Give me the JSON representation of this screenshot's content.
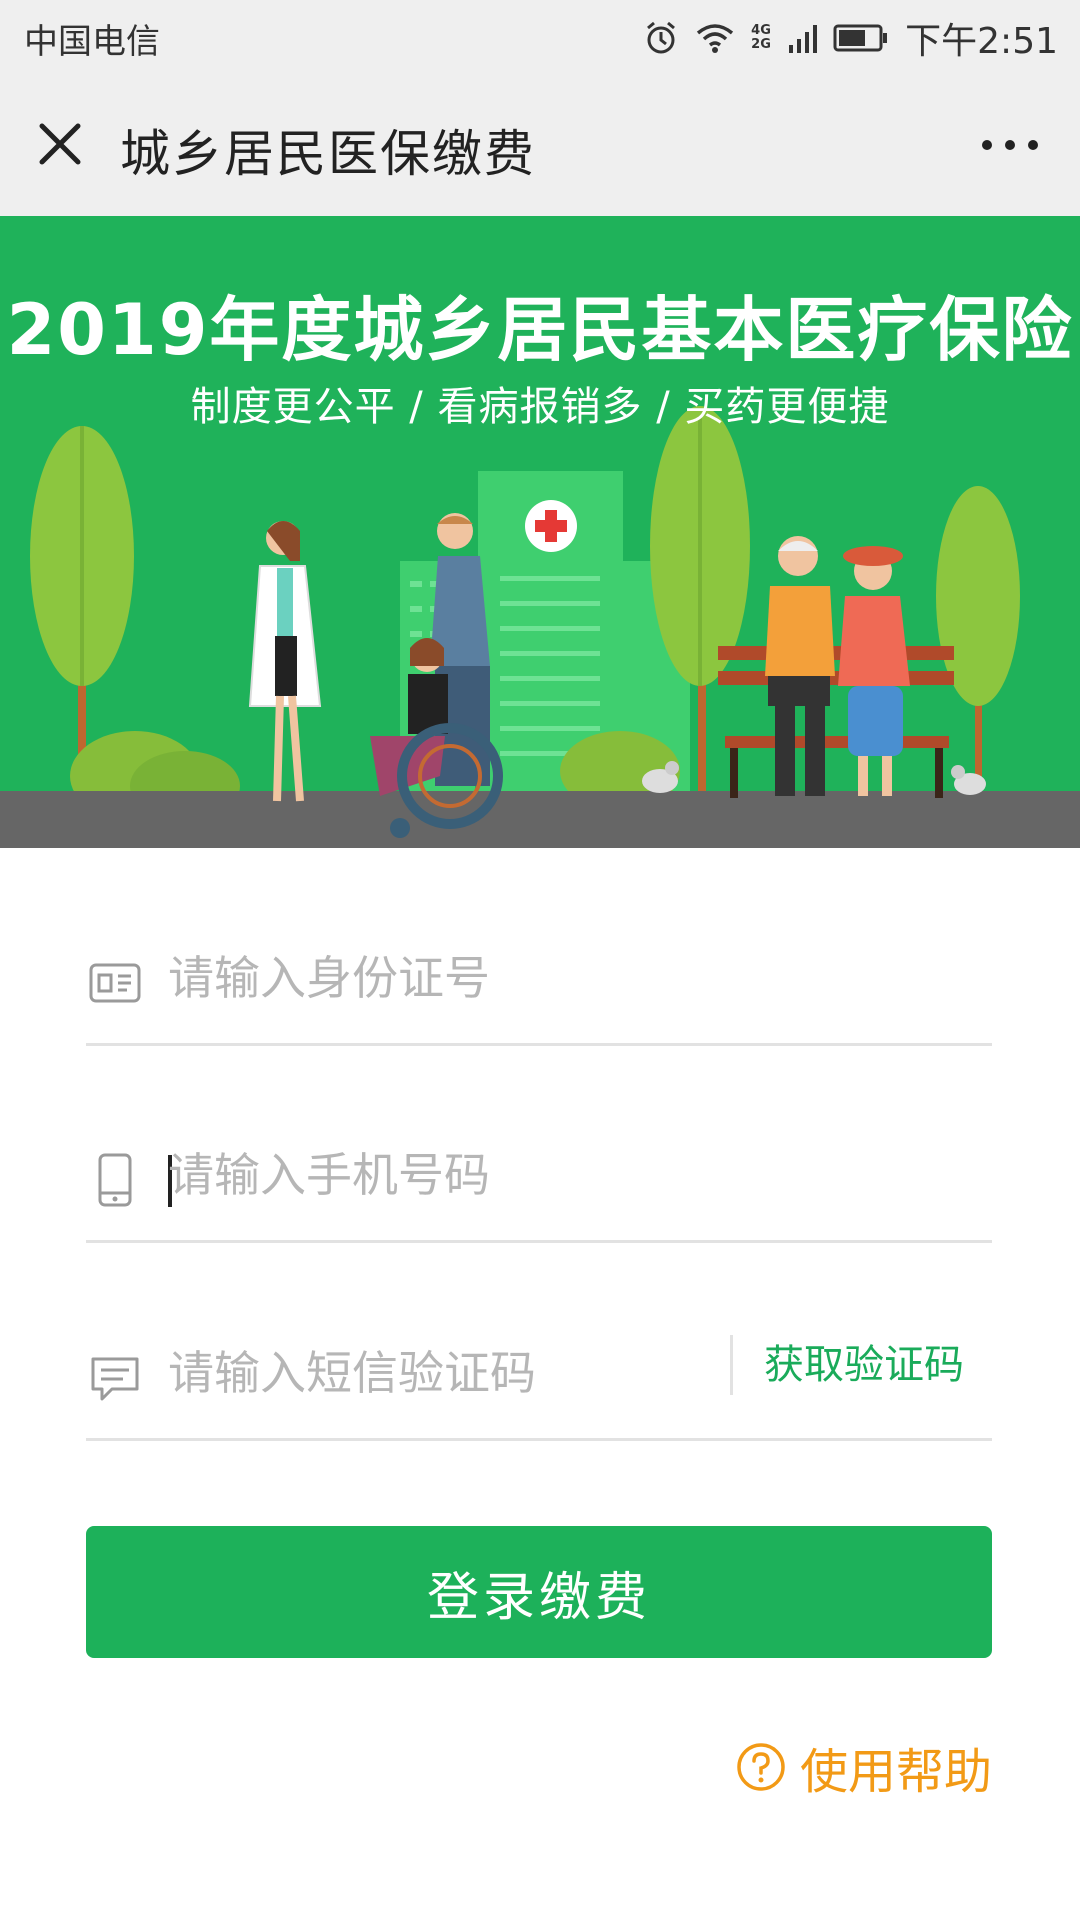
{
  "status_bar": {
    "carrier": "中国电信",
    "network": "4G 2G",
    "time": "下午2:51"
  },
  "nav": {
    "title": "城乡居民医保缴费",
    "close_icon": "close-icon",
    "more_icon": "more-icon"
  },
  "banner": {
    "title": "2019年度城乡居民基本医疗保险",
    "subtitle": "制度更公平 / 看病报销多 / 买药更便捷"
  },
  "form": {
    "id_field": {
      "placeholder": "请输入身份证号",
      "value": "",
      "icon": "id-card-icon"
    },
    "phone_field": {
      "placeholder": "请输入手机号码",
      "value": "",
      "icon": "phone-icon"
    },
    "sms_field": {
      "placeholder": "请输入短信验证码",
      "value": "",
      "icon": "message-icon"
    },
    "get_code_label": "获取验证码",
    "login_label": "登录缴费"
  },
  "help": {
    "label": "使用帮助",
    "icon": "question-icon"
  },
  "colors": {
    "brand_green": "#1db15a",
    "help_orange": "#f29a16",
    "background": "#ffffff",
    "bar_gray": "#efefef"
  }
}
